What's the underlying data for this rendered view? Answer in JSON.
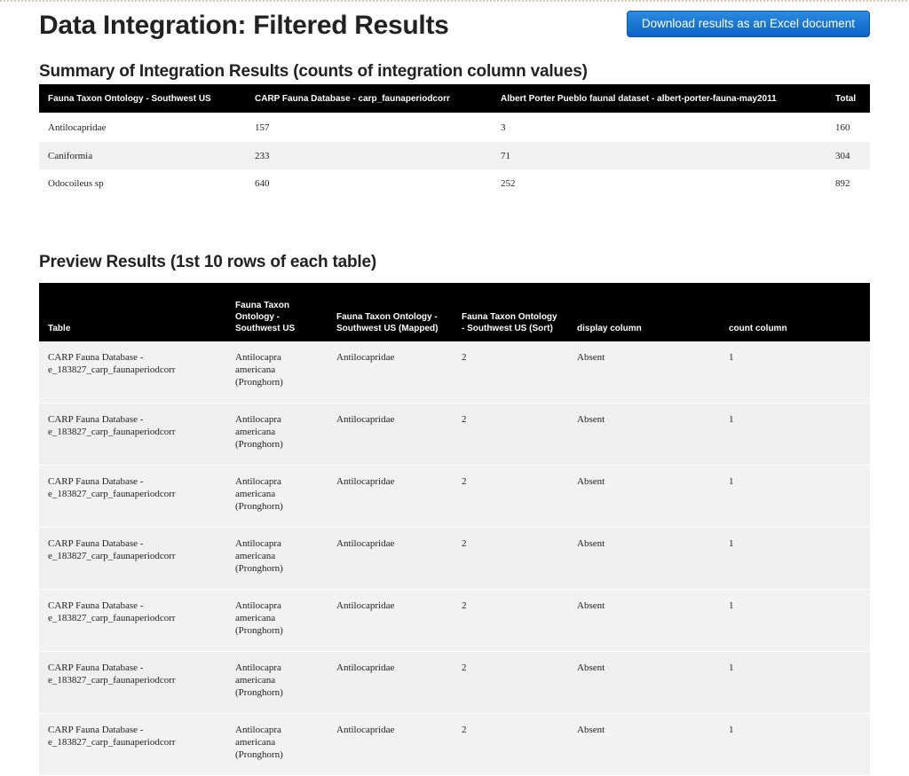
{
  "header": {
    "title": "Data Integration: Filtered Results",
    "download_label": "Download results as an Excel document"
  },
  "summary": {
    "title": "Summary of Integration Results (counts of integration column values)",
    "columns": [
      "Fauna Taxon Ontology - Southwest US",
      "CARP Fauna Database - carp_faunaperiodcorr",
      "Albert Porter Pueblo faunal dataset - albert-porter-fauna-may2011",
      "Total"
    ],
    "rows": [
      [
        "Antilocapridae",
        "157",
        "3",
        "160"
      ],
      [
        "Caniformia",
        "233",
        "71",
        "304"
      ],
      [
        "Odocoileus sp",
        "640",
        "252",
        "892"
      ]
    ]
  },
  "preview": {
    "title": "Preview Results (1st 10 rows of each table)",
    "columns": [
      "Table",
      "Fauna Taxon Ontology - Southwest US",
      "Fauna Taxon Ontology - Southwest US (Mapped)",
      "Fauna Taxon Ontology - Southwest US (Sort)",
      "display column",
      "count column"
    ],
    "rows": [
      [
        "CARP Fauna Database - e_183827_carp_faunaperiodcorr",
        "Antilocapra americana (Pronghorn)",
        "Antilocapridae",
        "2",
        "Absent",
        "1"
      ],
      [
        "CARP Fauna Database - e_183827_carp_faunaperiodcorr",
        "Antilocapra americana (Pronghorn)",
        "Antilocapridae",
        "2",
        "Absent",
        "1"
      ],
      [
        "CARP Fauna Database - e_183827_carp_faunaperiodcorr",
        "Antilocapra americana (Pronghorn)",
        "Antilocapridae",
        "2",
        "Absent",
        "1"
      ],
      [
        "CARP Fauna Database - e_183827_carp_faunaperiodcorr",
        "Antilocapra americana (Pronghorn)",
        "Antilocapridae",
        "2",
        "Absent",
        "1"
      ],
      [
        "CARP Fauna Database - e_183827_carp_faunaperiodcorr",
        "Antilocapra americana (Pronghorn)",
        "Antilocapridae",
        "2",
        "Absent",
        "1"
      ],
      [
        "CARP Fauna Database - e_183827_carp_faunaperiodcorr",
        "Antilocapra americana (Pronghorn)",
        "Antilocapridae",
        "2",
        "Absent",
        "1"
      ],
      [
        "CARP Fauna Database - e_183827_carp_faunaperiodcorr",
        "Antilocapra americana (Pronghorn)",
        "Antilocapridae",
        "2",
        "Absent",
        "1"
      ]
    ]
  }
}
